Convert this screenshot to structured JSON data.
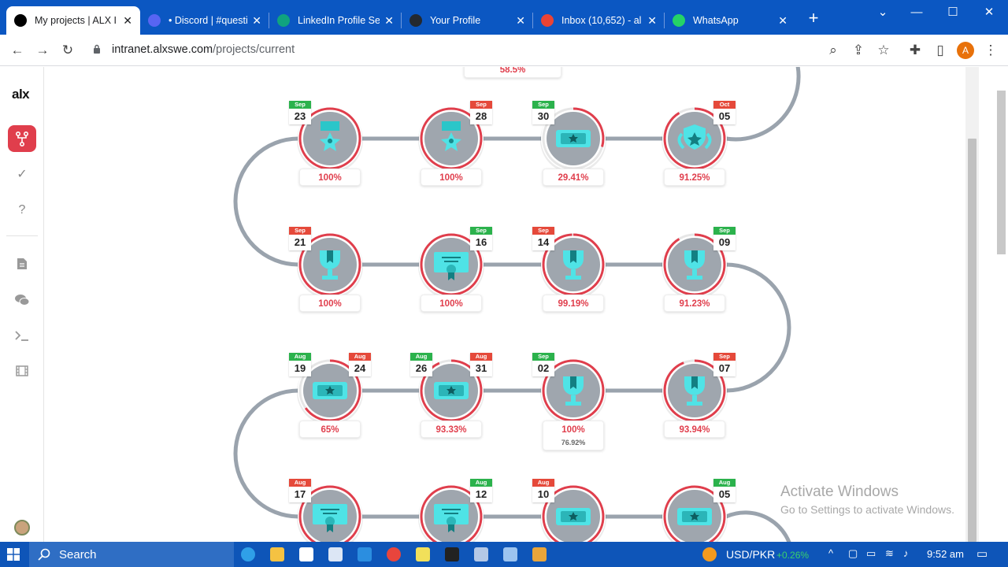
{
  "tabs": [
    {
      "title": "My projects | ALX I",
      "active": true,
      "favicon": "alx-icon",
      "color": "#000000"
    },
    {
      "title": "• Discord | #questi",
      "favicon": "discord-icon",
      "color": "#5865f2"
    },
    {
      "title": "LinkedIn Profile Se",
      "favicon": "openai-icon",
      "color": "#10a37f"
    },
    {
      "title": "Your Profile",
      "favicon": "github-icon",
      "color": "#24292f"
    },
    {
      "title": "Inbox (10,652) - al",
      "favicon": "gmail-icon",
      "color": "#ea4335"
    },
    {
      "title": "WhatsApp",
      "favicon": "whatsapp-icon",
      "color": "#25d366"
    }
  ],
  "address": {
    "domain": "intranet.alxswe.com",
    "path": "/projects/current"
  },
  "profile_initial": "A",
  "sidebar": {
    "logo": "alx",
    "items": [
      "projects-icon",
      "check-icon",
      "help-icon",
      "document-icon",
      "chat-icon",
      "terminal-icon",
      "video-icon"
    ]
  },
  "top_partial_pct": "58.5%",
  "rows": [
    {
      "nodes": [
        {
          "dates": [
            {
              "m": "Sep",
              "d": "23",
              "c": "g"
            }
          ],
          "pct": "100%",
          "icon": "medal",
          "progress": 1
        },
        {
          "dates": [
            {
              "m": "Sep",
              "d": "28",
              "c": "r"
            }
          ],
          "pct": "100%",
          "icon": "medal",
          "progress": 1
        },
        {
          "dates": [
            {
              "m": "Sep",
              "d": "30",
              "c": "g"
            }
          ],
          "pct": "29.41%",
          "icon": "ticket",
          "progress": 0.2941
        },
        {
          "dates": [
            {
              "m": "Oct",
              "d": "05",
              "c": "r"
            }
          ],
          "pct": "91.25%",
          "icon": "shield",
          "progress": 0.9125
        }
      ]
    },
    {
      "nodes": [
        {
          "dates": [
            {
              "m": "Sep",
              "d": "21",
              "c": "r"
            }
          ],
          "pct": "100%",
          "icon": "trophy",
          "progress": 1
        },
        {
          "dates": [
            {
              "m": "Sep",
              "d": "16",
              "c": "g"
            }
          ],
          "pct": "100%",
          "icon": "certificate",
          "progress": 1
        },
        {
          "dates": [
            {
              "m": "Sep",
              "d": "14",
              "c": "r"
            }
          ],
          "pct": "99.19%",
          "icon": "trophy",
          "progress": 0.9919
        },
        {
          "dates": [
            {
              "m": "Sep",
              "d": "09",
              "c": "g"
            }
          ],
          "pct": "91.23%",
          "icon": "trophy",
          "progress": 0.9123
        }
      ]
    },
    {
      "nodes": [
        {
          "dates": [
            {
              "m": "Aug",
              "d": "19",
              "c": "g"
            },
            {
              "m": "Aug",
              "d": "24",
              "c": "r"
            }
          ],
          "pct": "65%",
          "icon": "ticket",
          "progress": 0.65
        },
        {
          "dates": [
            {
              "m": "Aug",
              "d": "26",
              "c": "g"
            },
            {
              "m": "Aug",
              "d": "31",
              "c": "r"
            }
          ],
          "pct": "93.33%",
          "icon": "ticket",
          "progress": 0.9333
        },
        {
          "dates": [
            {
              "m": "Sep",
              "d": "02",
              "c": "g"
            }
          ],
          "pct": "100%",
          "sub": "76.92%",
          "icon": "trophy",
          "progress": 1
        },
        {
          "dates": [
            {
              "m": "Sep",
              "d": "07",
              "c": "r"
            }
          ],
          "pct": "93.94%",
          "icon": "trophy",
          "progress": 0.9394
        }
      ]
    },
    {
      "nodes": [
        {
          "dates": [
            {
              "m": "Aug",
              "d": "17",
              "c": "r"
            }
          ],
          "pct": "",
          "icon": "certificate",
          "progress": 1
        },
        {
          "dates": [
            {
              "m": "Aug",
              "d": "12",
              "c": "g"
            }
          ],
          "pct": "",
          "icon": "certificate",
          "progress": 1
        },
        {
          "dates": [
            {
              "m": "Aug",
              "d": "10",
              "c": "r"
            }
          ],
          "pct": "",
          "icon": "ticket",
          "progress": 1
        },
        {
          "dates": [
            {
              "m": "Aug",
              "d": "05",
              "c": "g"
            }
          ],
          "pct": "",
          "icon": "ticket",
          "progress": 1
        }
      ]
    }
  ],
  "watermark": {
    "line1": "Activate Windows",
    "line2": "Go to Settings to activate Windows."
  },
  "taskbar": {
    "search": "Search",
    "stock": "USD/PKR",
    "stock_change": "+0.26%",
    "time": "9:52 am"
  },
  "colors": {
    "accent": "#e03e4c",
    "path": "#9aa3ad",
    "node_fill": "#9fa6ae",
    "icon_cyan": "#4fe3e6"
  }
}
